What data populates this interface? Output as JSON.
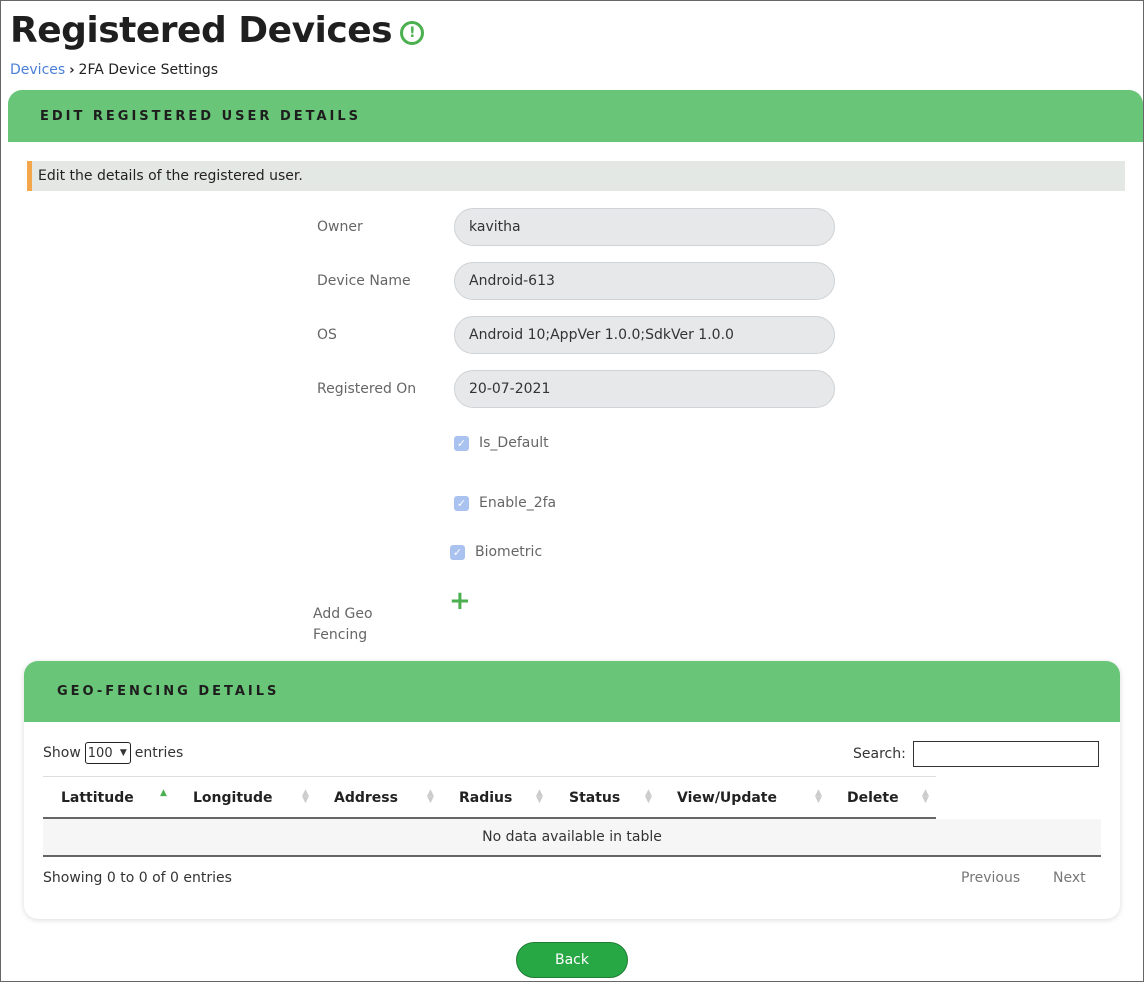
{
  "header": {
    "title": "Registered Devices",
    "info_icon": "exclamation-circle-icon"
  },
  "breadcrumb": {
    "link": "Devices",
    "separator": "›",
    "current": "2FA Device Settings"
  },
  "edit_section": {
    "title": "EDIT REGISTERED USER DETAILS",
    "note": "Edit the details of the registered user.",
    "fields": [
      {
        "label": "Owner",
        "value": "kavitha"
      },
      {
        "label": "Device Name",
        "value": "Android-613"
      },
      {
        "label": "OS",
        "value": "Android 10;AppVer 1.0.0;SdkVer 1.0.0"
      },
      {
        "label": "Registered On",
        "value": "20-07-2021"
      }
    ],
    "checkboxes": [
      {
        "label": "Is_Default",
        "checked": true
      },
      {
        "label": "Enable_2fa",
        "checked": true
      },
      {
        "label": "Biometric",
        "checked": true
      }
    ],
    "geo_label": "Add Geo Fencing",
    "geo_icon": "plus-icon"
  },
  "geo_section": {
    "title": "GEO-FENCING DETAILS",
    "show_label": "Show",
    "entries_value": "100",
    "entries_label": "entries",
    "search_label": "Search:",
    "columns": [
      "Lattitude",
      "Longitude",
      "Address",
      "Radius",
      "Status",
      "View/Update",
      "Delete"
    ],
    "empty_message": "No data available in table",
    "info": "Showing 0 to 0 of 0 entries",
    "previous": "Previous",
    "next": "Next"
  },
  "back_label": "Back",
  "colors": {
    "header_green": "#69c577",
    "accent_orange": "#f3a64a",
    "button_green": "#28a745",
    "link_blue": "#4a7fd6"
  }
}
